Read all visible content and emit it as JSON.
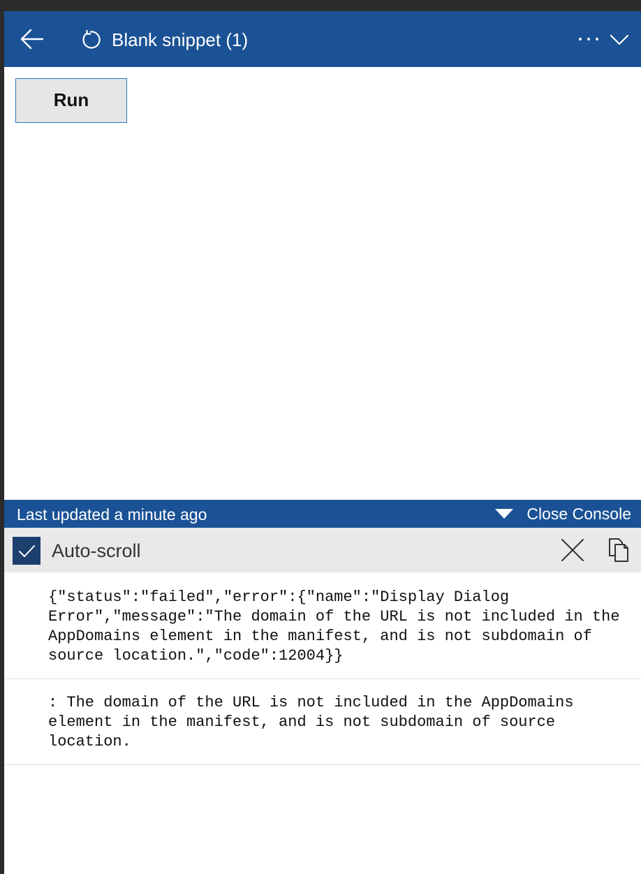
{
  "header": {
    "title": "Blank snippet (1)",
    "icons": {
      "back": "back-arrow-icon",
      "refresh": "refresh-icon",
      "more": "more-icon",
      "expand": "chevron-down-icon"
    },
    "background_color": "#1b5295"
  },
  "main": {
    "run_label": "Run"
  },
  "console": {
    "last_updated": "Last updated a minute ago",
    "close_label": "Close Console",
    "autoscroll_label": "Auto-scroll",
    "autoscroll_checked": true,
    "toolbar_icons": {
      "clear": "close-icon",
      "copy": "copy-icon"
    },
    "entries": [
      "{\"status\":\"failed\",\"error\":{\"name\":\"Display Dialog Error\",\"message\":\"The domain of the URL is not included in the AppDomains element in the manifest, and is not subdomain of source location.\",\"code\":12004}}",
      ": The domain of the URL is not included in the AppDomains element in the manifest, and is not subdomain of source location."
    ]
  }
}
